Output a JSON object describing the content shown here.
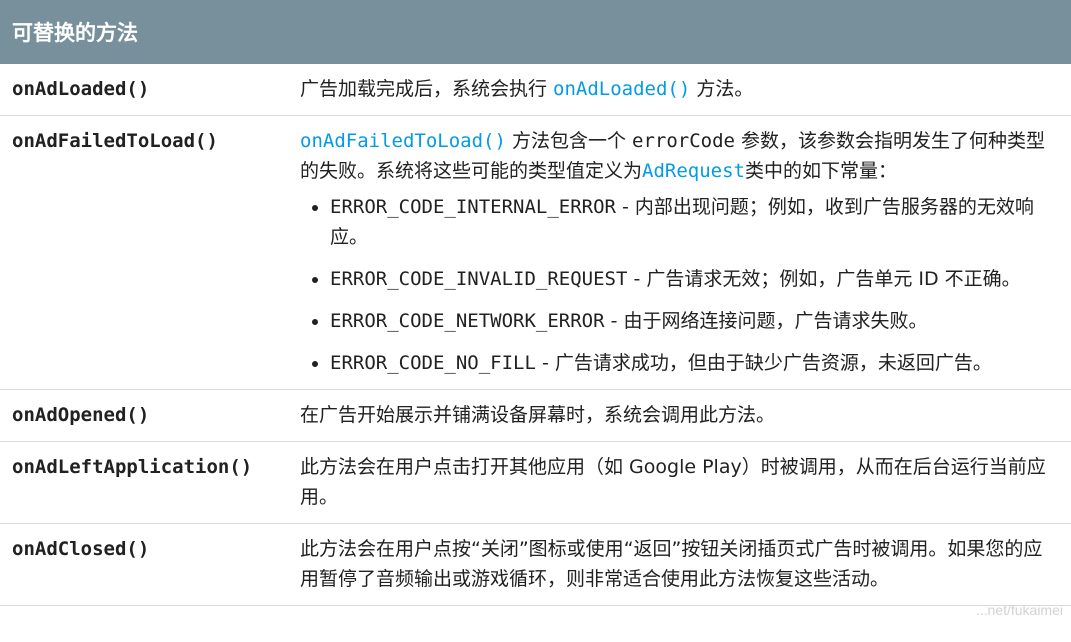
{
  "header": {
    "title": "可替换的方法"
  },
  "rows": {
    "loaded": {
      "name": "onAdLoaded()",
      "pre": "广告加载完成后，系统会执行 ",
      "link": "onAdLoaded()",
      "post": " 方法。"
    },
    "failed": {
      "name": "onAdFailedToLoad()",
      "link1": "onAdFailedToLoad()",
      "t1": " 方法包含一个 ",
      "code1": "errorCode",
      "t2": " 参数，该参数会指明发生了何种类型的失败。系统将这些可能的类型值定义为",
      "link2": "AdRequest",
      "t3": "类中的如下常量：",
      "errors": [
        {
          "code": "ERROR_CODE_INTERNAL_ERROR",
          "desc": " - 内部出现问题；例如，收到广告服务器的无效响应。"
        },
        {
          "code": "ERROR_CODE_INVALID_REQUEST",
          "desc": " - 广告请求无效；例如，广告单元 ID 不正确。"
        },
        {
          "code": "ERROR_CODE_NETWORK_ERROR",
          "desc": " - 由于网络连接问题，广告请求失败。"
        },
        {
          "code": "ERROR_CODE_NO_FILL",
          "desc": " - 广告请求成功，但由于缺少广告资源，未返回广告。"
        }
      ]
    },
    "opened": {
      "name": "onAdOpened()",
      "desc": "在广告开始展示并铺满设备屏幕时，系统会调用此方法。"
    },
    "left": {
      "name": "onAdLeftApplication()",
      "desc": "此方法会在用户点击打开其他应用（如 Google Play）时被调用，从而在后台运行当前应用。"
    },
    "closed": {
      "name": "onAdClosed()",
      "desc": "此方法会在用户点按“关闭”图标或使用“返回”按钮关闭插页式广告时被调用。如果您的应用暂停了音频输出或游戏循环，则非常适合使用此方法恢复这些活动。"
    }
  },
  "watermark": "...net/fukaimei",
  "colors": {
    "header_bg": "#78909c",
    "link": "#039be5",
    "border": "#dcdcdc"
  }
}
